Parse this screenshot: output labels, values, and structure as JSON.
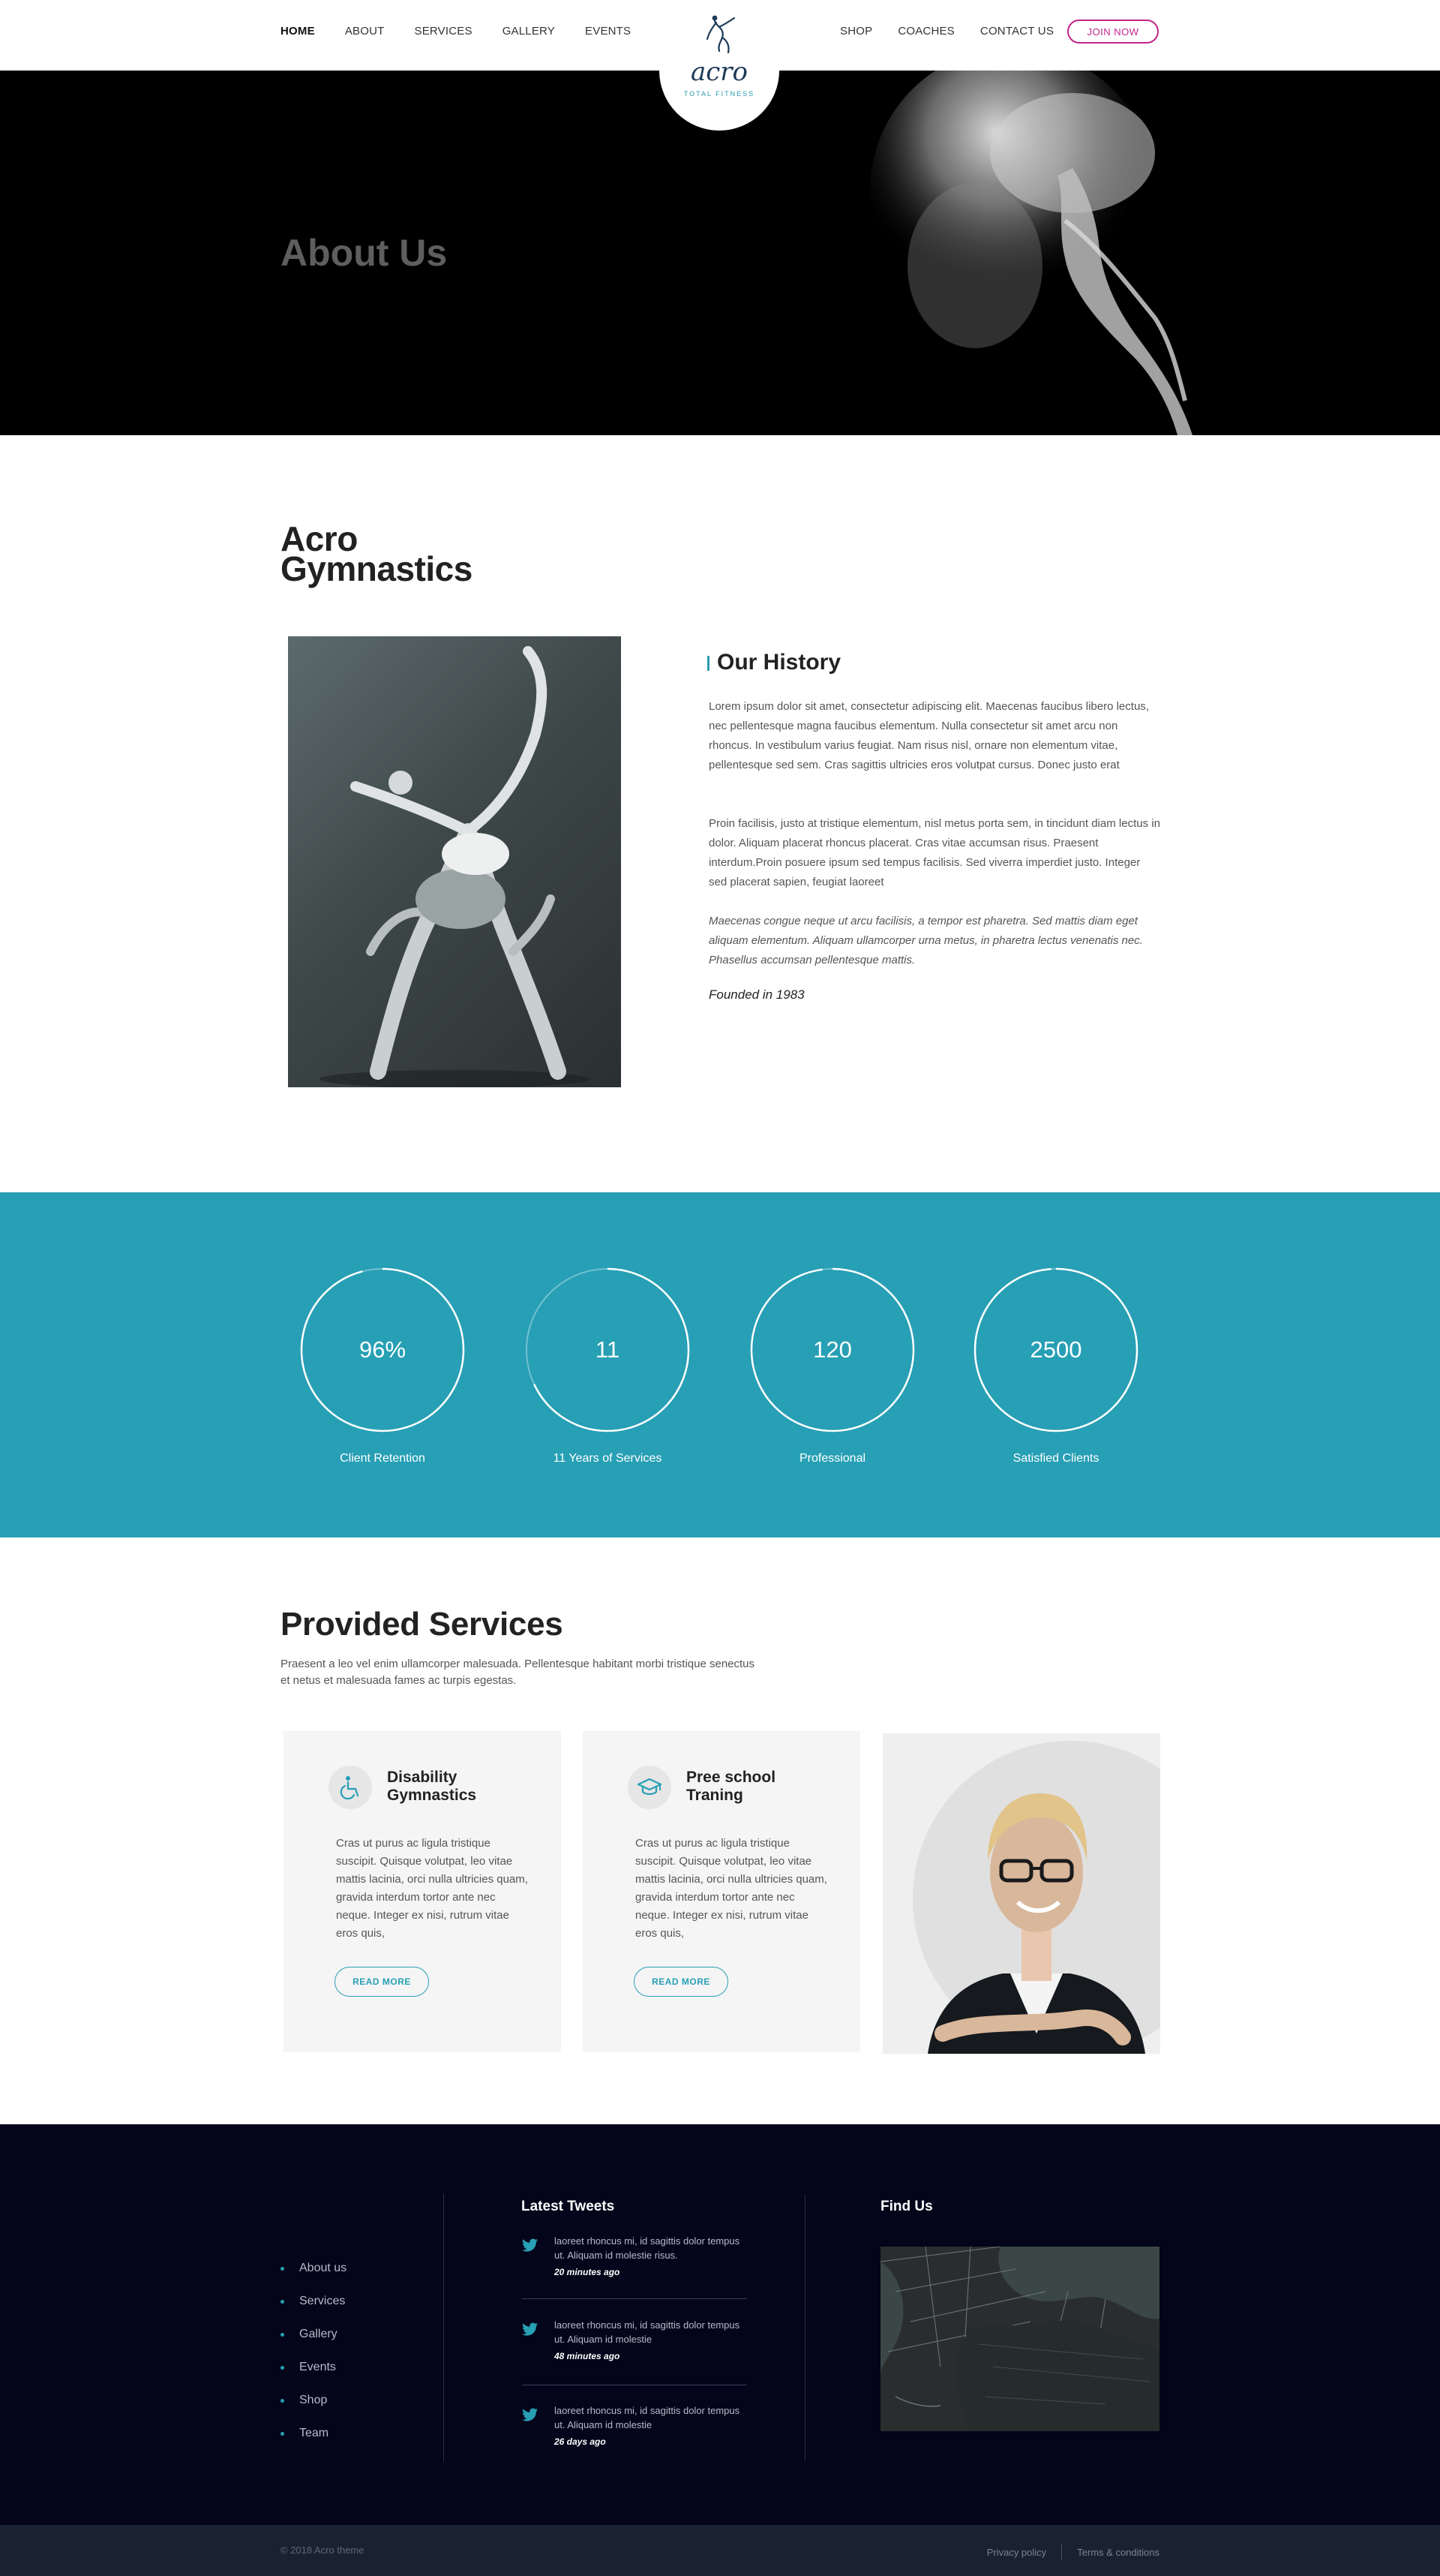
{
  "nav": {
    "left": [
      "HOME",
      "ABOUT",
      "SERVICES",
      "GALLERY",
      "EVENTS"
    ],
    "right": [
      "SHOP",
      "COACHES",
      "CONTACT US"
    ],
    "join": "JOIN NOW",
    "logo_word": "acro",
    "logo_sub": "TOTAL FITNESS"
  },
  "hero": {
    "title": "About Us"
  },
  "acro": {
    "title_line1": "Acro",
    "title_line2": "Gymnastics",
    "history_title": "Our History",
    "p1": "Lorem ipsum dolor sit amet, consectetur adipiscing elit. Maecenas faucibus libero lectus, nec pellentesque magna faucibus elementum. Nulla consectetur sit amet arcu non rhoncus. In vestibulum varius feugiat. Nam risus nisl, ornare non elementum vitae, pellentesque sed sem. Cras sagittis ultricies eros volutpat cursus. Donec justo erat",
    "p2": "Proin facilisis, justo at tristique elementum, nisl metus porta sem, in tincidunt diam lectus in dolor. Aliquam placerat rhoncus placerat. Cras vitae accumsan risus. Praesent interdum.Proin posuere ipsum sed tempus facilisis. Sed viverra imperdiet justo. Integer sed placerat sapien, feugiat laoreet",
    "p3": "Maecenas congue neque ut arcu facilisis, a tempor est pharetra. Sed mattis diam eget aliquam elementum. Aliquam ullamcorper urna metus, in pharetra lectus venenatis nec. Phasellus accumsan pellentesque mattis.",
    "founded": "Founded in 1983"
  },
  "stats": [
    {
      "value": "96%",
      "label": "Client Retention",
      "progress": 0.96
    },
    {
      "value": "11",
      "label": "11 Years of Services",
      "progress": 0.68
    },
    {
      "value": "120",
      "label": "Professional",
      "progress": 0.98
    },
    {
      "value": "2500",
      "label": "Satisfied Clients",
      "progress": 0.99
    }
  ],
  "services": {
    "title": "Provided Services",
    "intro": "Praesent a leo vel enim ullamcorper malesuada. Pellentesque habitant morbi tristique senectus et netus et malesuada fames ac turpis egestas.",
    "cards": [
      {
        "name": "Disability Gymnastics",
        "icon": "wheelchair-icon",
        "text": "Cras ut purus ac ligula tristique suscipit. Quisque volutpat, leo vitae mattis lacinia, orci nulla ultricies quam, gravida interdum tortor ante nec neque. Integer ex nisi, rutrum vitae eros quis,",
        "button": "READ MORE"
      },
      {
        "name": "Pree school Traning",
        "icon": "graduation-cap-icon",
        "text": "Cras ut purus ac ligula tristique suscipit. Quisque volutpat, leo vitae mattis lacinia, orci nulla ultricies quam, gravida interdum tortor ante nec neque. Integer ex nisi, rutrum vitae eros quis,",
        "button": "READ MORE"
      }
    ]
  },
  "footer": {
    "links": [
      "About us",
      "Services",
      "Gallery",
      "Events",
      "Shop",
      "Team"
    ],
    "tweets_title": "Latest Tweets",
    "tweets": [
      {
        "text": "laoreet rhoncus mi, id sagittis dolor tempus ut. Aliquam id molestie risus.",
        "when": "20 minutes ago"
      },
      {
        "text": "laoreet rhoncus mi, id sagittis dolor tempus ut. Aliquam id molestie",
        "when": "48 minutes ago"
      },
      {
        "text": "laoreet rhoncus mi, id sagittis dolor tempus ut. Aliquam id molestie",
        "when": "26 days ago"
      }
    ],
    "find_title": "Find Us",
    "copyright": "© 2018 Acro theme",
    "privacy": "Privacy policy",
    "terms": "Terms & conditions"
  },
  "colors": {
    "accent": "#279fb5",
    "brand": "#c2248a",
    "footer": "#04041a",
    "navy": "#1d3a57"
  }
}
